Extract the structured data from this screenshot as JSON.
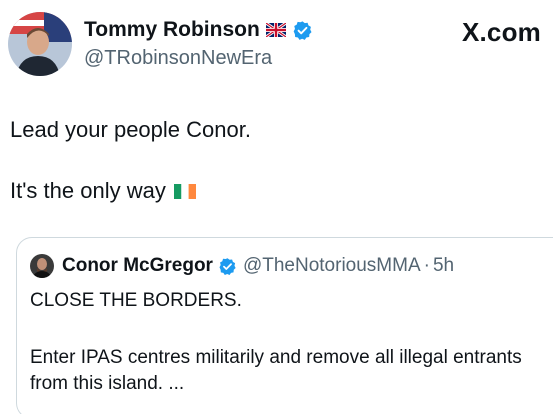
{
  "author": {
    "display_name": "Tommy Robinson",
    "handle": "@TRobinsonNewEra",
    "flag_icon": "uk-flag-icon",
    "verified_icon": "verified-badge-icon",
    "avatar_icon": "profile-avatar"
  },
  "brand": "X.com",
  "tweet": {
    "line1": "Lead your people Conor.",
    "line2": "It's the only way",
    "flag_icon": "ireland-flag-icon"
  },
  "quoted_tweet": {
    "display_name": "Conor McGregor",
    "handle": "@TheNotoriousMMA",
    "separator": "·",
    "time": "5h",
    "line1": "CLOSE THE BORDERS.",
    "line2": "Enter IPAS centres militarily and remove all illegal entrants from this island. ..."
  },
  "colors": {
    "text": "#0f1419",
    "secondary": "#536471",
    "verified": "#1d9bf0",
    "border": "#cfd9de"
  }
}
